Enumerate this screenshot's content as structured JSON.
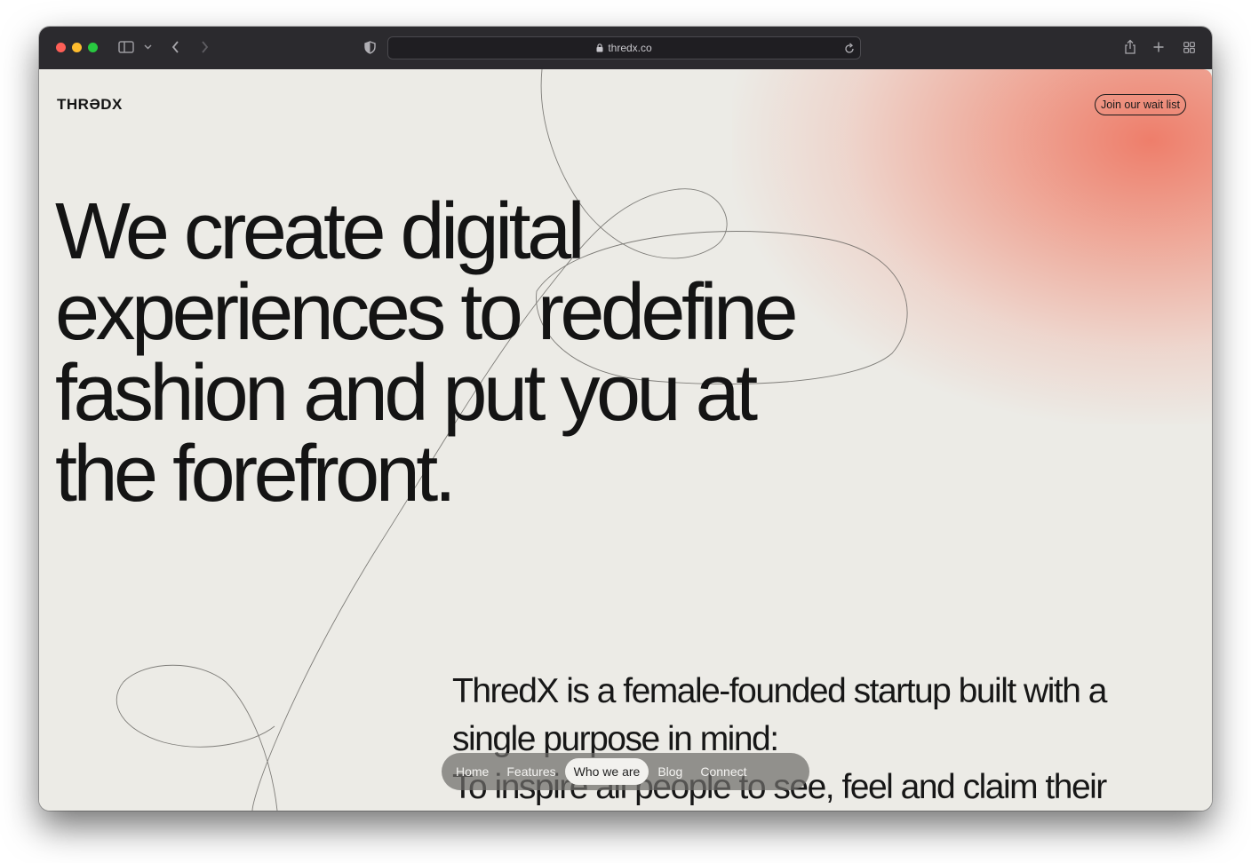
{
  "browser": {
    "url": "thredx.co",
    "icons": [
      "close-dot",
      "minimize-dot",
      "zoom-dot",
      "sidebar-icon",
      "chevron-down-icon",
      "back-icon",
      "forward-icon",
      "shield-icon",
      "lock-icon",
      "reload-icon",
      "share-icon",
      "new-tab-icon",
      "tab-overview-icon"
    ]
  },
  "site": {
    "logo": "THRƏDX",
    "waitlist_label": "Join our wait list",
    "headline": [
      "We create digital",
      "experiences to redefine",
      "fashion and put you at",
      "the forefront."
    ],
    "body": [
      "ThredX is a female-founded startup built with a",
      "single purpose in mind:",
      "To inspire all people to see, feel and claim their"
    ],
    "nav": [
      {
        "label": "Home",
        "active": false
      },
      {
        "label": "Features",
        "active": false
      },
      {
        "label": "Who we are",
        "active": true
      },
      {
        "label": "Blog",
        "active": false
      },
      {
        "label": "Connect",
        "active": false
      }
    ]
  },
  "colors": {
    "page_bg": "#ecebe6",
    "accent_glow": "#ee7864",
    "text": "#141414",
    "titlebar": "#2b2a2e"
  }
}
